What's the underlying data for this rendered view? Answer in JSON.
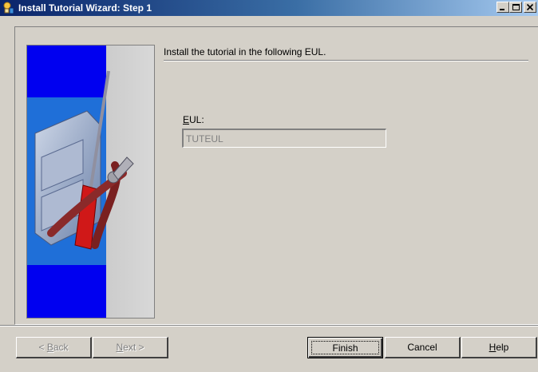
{
  "window": {
    "title": "Install Tutorial Wizard: Step 1",
    "controls": [
      "minimize",
      "maximize",
      "close"
    ]
  },
  "main": {
    "instruction": "Install the tutorial in the following EUL.",
    "eul_label_underlined": "E",
    "eul_label_rest": "UL:",
    "eul_value": "TUTEUL"
  },
  "buttons": {
    "back_prefix": "< ",
    "back_mn": "B",
    "back_rest": "ack",
    "next_mn": "N",
    "next_rest": "ext >",
    "finish": "Finish",
    "cancel": "Cancel",
    "help_mn": "H",
    "help_rest": "elp"
  },
  "image": {
    "icon": "tools-file-cabinet-illustration"
  }
}
